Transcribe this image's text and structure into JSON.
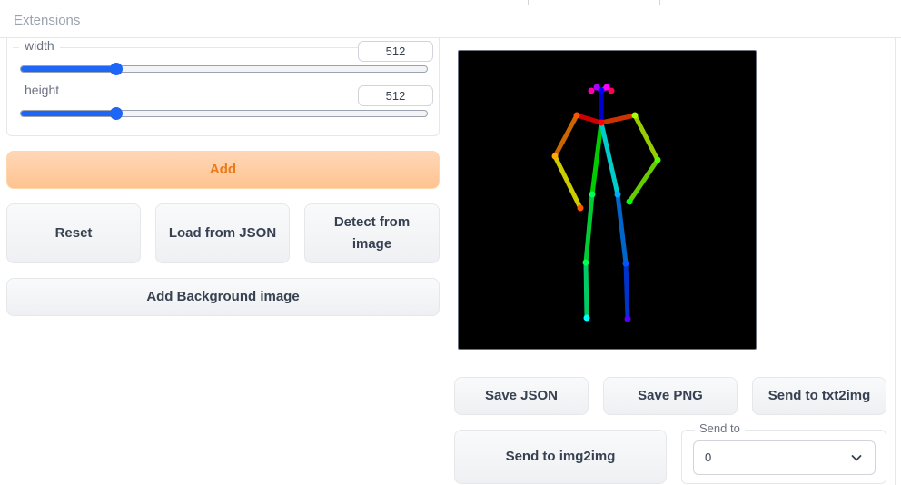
{
  "header": {
    "tab_label": "Extensions"
  },
  "sliders": [
    {
      "label": "width",
      "value": "512",
      "fraction": 0.235
    },
    {
      "label": "height",
      "value": "512",
      "fraction": 0.235
    }
  ],
  "buttons": {
    "add": "Add",
    "reset": "Reset",
    "load_json": "Load from JSON",
    "detect": "Detect from image",
    "add_background": "Add Background image",
    "save_json": "Save JSON",
    "save_png": "Save PNG",
    "send_txt2img": "Send to txt2img",
    "send_img2img": "Send to img2img"
  },
  "send_to": {
    "label": "Send to",
    "selected": "0",
    "icon": "chevron-down-icon"
  },
  "canvas": {
    "background": "#000000",
    "content": "openpose skeleton"
  },
  "colors": {
    "accent": "#1e66f5",
    "primary_text": "#ea7a1a",
    "primary_bg": "#ffc38f"
  }
}
